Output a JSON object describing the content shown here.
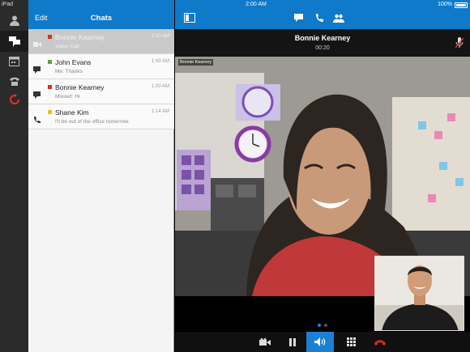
{
  "status": {
    "carrier": "iPad",
    "time": "2:00 AM",
    "battery": "100%"
  },
  "chats_panel": {
    "edit_label": "Edit",
    "title": "Chats"
  },
  "chats": [
    {
      "name": "Bonnie Kearney",
      "preview": "Video Call",
      "time": "1:00 AM",
      "presence_color": "#d6301f",
      "kind": "video",
      "selected": true
    },
    {
      "name": "John Evans",
      "preview": "Me: Thanks",
      "time": "1:43 AM",
      "presence_color": "#5aa83a",
      "kind": "chat",
      "selected": false
    },
    {
      "name": "Bonnie Kearney",
      "preview": "Missed: Hi",
      "time": "1:00 AM",
      "presence_color": "#d6301f",
      "kind": "chat",
      "selected": false
    },
    {
      "name": "Shane Kim",
      "preview": "I'll be out of the office tomorrow.",
      "time": "1:14 AM",
      "presence_color": "#e8c21d",
      "kind": "phone",
      "selected": false
    }
  ],
  "call": {
    "contact_name": "Bonnie Kearney",
    "duration": "00:20",
    "video_caption": "Bonnie Kearney"
  },
  "rail_icons": [
    "contact-icon",
    "chats-icon",
    "meetings-icon",
    "voicemail-icon",
    "sync-icon"
  ],
  "topbar_icons": [
    "sidebar-toggle-icon",
    "chat-bubble-icon",
    "phone-icon",
    "participants-icon"
  ],
  "control_icons": [
    "video-camera-icon",
    "pause-icon",
    "speaker-icon",
    "keypad-icon",
    "end-call-icon"
  ],
  "colors": {
    "accent": "#0e7ac9",
    "end_call": "#d22a1e",
    "active_control": "#1b7fd2"
  }
}
